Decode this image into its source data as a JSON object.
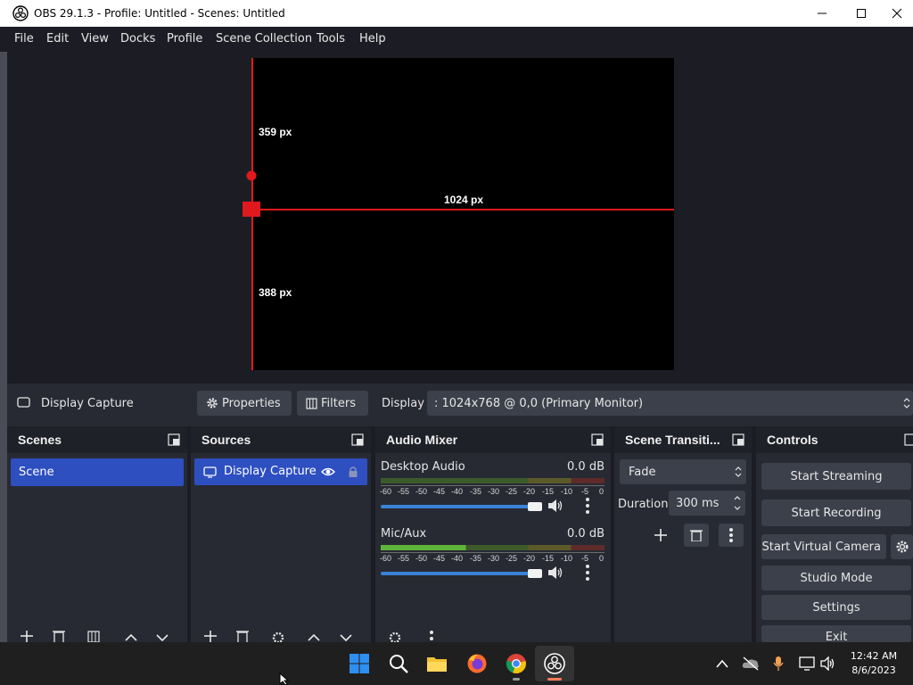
{
  "window": {
    "title": "OBS 29.1.3 - Profile: Untitled - Scenes: Untitled"
  },
  "menu": [
    "File",
    "Edit",
    "View",
    "Docks",
    "Profile",
    "Scene Collection",
    "Tools",
    "Help"
  ],
  "preview": {
    "top_label": "359 px",
    "width_label": "1024 px",
    "bottom_label": "388 px"
  },
  "source_toolbar": {
    "source_name": "Display Capture",
    "properties_label": "Properties",
    "filters_label": "Filters",
    "display_label": "Display",
    "display_value": ": 1024x768 @ 0,0 (Primary Monitor)"
  },
  "docks": {
    "scenes": {
      "title": "Scenes",
      "items": [
        "Scene"
      ]
    },
    "sources": {
      "title": "Sources",
      "items": [
        "Display Capture"
      ]
    },
    "audio_mixer": {
      "title": "Audio Mixer",
      "channels": [
        {
          "name": "Desktop Audio",
          "level": "0.0 dB"
        },
        {
          "name": "Mic/Aux",
          "level": "0.0 dB"
        }
      ],
      "ticks": [
        "-60",
        "-55",
        "-50",
        "-45",
        "-40",
        "-35",
        "-30",
        "-25",
        "-20",
        "-15",
        "-10",
        "-5",
        "0"
      ]
    },
    "transitions": {
      "title": "Scene Transiti...",
      "transition": "Fade",
      "duration_label": "Duration",
      "duration_value": "300 ms"
    },
    "controls": {
      "title": "Controls",
      "buttons": [
        "Start Streaming",
        "Start Recording",
        "Start Virtual Camera",
        "Studio Mode",
        "Settings",
        "Exit"
      ]
    }
  },
  "taskbar": {
    "time": "12:42 AM",
    "date": "8/6/2023"
  },
  "colors": {
    "accent": "#2e4fc0",
    "guide_red": "#e0191e",
    "panel": "#272a33",
    "background": "#1c1d24"
  }
}
